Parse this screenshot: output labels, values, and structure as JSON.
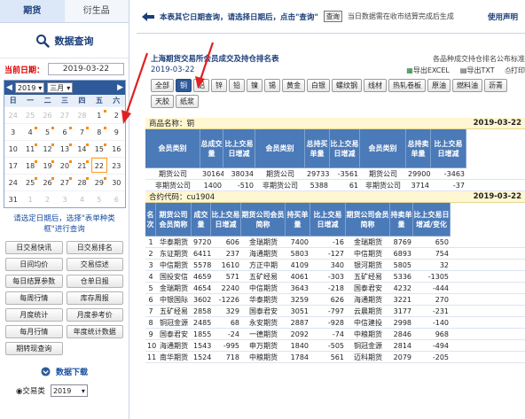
{
  "left": {
    "tabs": [
      "期货",
      "衍生品"
    ],
    "query_title": "数据查询",
    "current_date_label": "当前日期：",
    "current_date": "2019-03-22",
    "calendar": {
      "year": "2019",
      "month": "三月",
      "weekdays": [
        "日",
        "一",
        "二",
        "三",
        "四",
        "五",
        "六"
      ],
      "days": [
        {
          "d": "24",
          "dim": true
        },
        {
          "d": "25",
          "dim": true
        },
        {
          "d": "26",
          "dim": true
        },
        {
          "d": "27",
          "dim": true
        },
        {
          "d": "28",
          "dim": true
        },
        {
          "d": "1",
          "mk": true
        },
        {
          "d": "2"
        },
        {
          "d": "3"
        },
        {
          "d": "4",
          "mk": true
        },
        {
          "d": "5",
          "mk": true
        },
        {
          "d": "6",
          "mk": true
        },
        {
          "d": "7",
          "mk": true
        },
        {
          "d": "8",
          "mk": true
        },
        {
          "d": "9"
        },
        {
          "d": "10"
        },
        {
          "d": "11",
          "mk": true
        },
        {
          "d": "12",
          "mk": true
        },
        {
          "d": "13",
          "mk": true
        },
        {
          "d": "14",
          "mk": true
        },
        {
          "d": "15",
          "mk": true
        },
        {
          "d": "16"
        },
        {
          "d": "17"
        },
        {
          "d": "18",
          "mk": true
        },
        {
          "d": "19",
          "mk": true
        },
        {
          "d": "20",
          "mk": true
        },
        {
          "d": "21",
          "mk": true
        },
        {
          "d": "22",
          "today": true
        },
        {
          "d": "23"
        },
        {
          "d": "24"
        },
        {
          "d": "25",
          "mk": true
        },
        {
          "d": "26",
          "mk": true
        },
        {
          "d": "27",
          "mk": true
        },
        {
          "d": "28",
          "mk": true
        },
        {
          "d": "29",
          "mk": true
        },
        {
          "d": "30"
        },
        {
          "d": "31"
        },
        {
          "d": "1",
          "dim": true
        },
        {
          "d": "2",
          "dim": true
        },
        {
          "d": "3",
          "dim": true
        },
        {
          "d": "4",
          "dim": true
        },
        {
          "d": "5",
          "dim": true
        },
        {
          "d": "6",
          "dim": true
        }
      ]
    },
    "hint": "请选定日期后，选择\"表单种类框\"进行查询",
    "buttons": [
      "日交易快讯",
      "日交易排名",
      "日间均价",
      "交易综述",
      "每日结算参数",
      "仓单日报",
      "每周行情",
      "库存周报",
      "月度统计",
      "月度参考价",
      "每月行情",
      "年度统计数据",
      "期转现查询"
    ],
    "download_title": "数据下载",
    "download_radio": "交易类",
    "download_year": "2019"
  },
  "right": {
    "instruction": "本表其它日期查询，请选择日期后，点击\"查询\"",
    "query_btn": "查询",
    "note": "当日数据需在收市结算完成后生成",
    "declaration": "使用声明",
    "report_title": "上海期货交易所会员成交及持仓排名表",
    "report_note": "各品种成交持仓排名公布标准",
    "report_date": "2019-03-22",
    "export_excel": "导出EXCEL",
    "export_txt": "导出TXT",
    "print": "打印",
    "chips": [
      "全部",
      "铜",
      "铝",
      "锌",
      "铅",
      "镍",
      "锡",
      "黄金",
      "白银",
      "螺纹钢",
      "线材",
      "热轧卷板",
      "原油",
      "燃料油",
      "沥青",
      "天胶",
      "纸浆"
    ],
    "product_label": "商品名称：铜",
    "product_date": "2019-03-22",
    "summary_headers": [
      "会员类别",
      "总成交量",
      "比上交易日增减",
      "会员类别",
      "总持买单量",
      "比上交易日增减",
      "会员类别",
      "总持卖单量",
      "比上交易日增减"
    ],
    "summary_rows": [
      [
        "期货公司",
        "301644",
        "38034",
        "期货公司",
        "297331",
        "-3561",
        "期货公司",
        "299005",
        "-3463"
      ],
      [
        "非期货公司",
        "1400",
        "-510",
        "非期货公司",
        "5388",
        "61",
        "非期货公司",
        "3714",
        "-37"
      ]
    ],
    "contract_label": "合约代码：cu1904",
    "contract_date": "2019-03-22",
    "detail_headers": [
      "名次",
      "期货公司会员简称",
      "成交量",
      "比上交易日增减",
      "期货公司会员简称",
      "持买单量",
      "比上交易日增减",
      "期货公司会员简称",
      "持卖单量",
      "比上交易日增减/变化"
    ],
    "detail_rows": [
      [
        "1",
        "华泰期货",
        "9720",
        "606",
        "金瑞期货",
        "7400",
        "-16",
        "金瑞期货",
        "8769",
        "650"
      ],
      [
        "2",
        "东证期货",
        "6411",
        "237",
        "海通期货",
        "5803",
        "-127",
        "中信期货",
        "6893",
        "754"
      ],
      [
        "3",
        "中信期货",
        "5578",
        "1610",
        "方正中期",
        "4109",
        "340",
        "银河期货",
        "5805",
        "32"
      ],
      [
        "4",
        "国投安信",
        "4659",
        "571",
        "五矿经易",
        "4061",
        "-303",
        "五矿经易",
        "5336",
        "-1305"
      ],
      [
        "5",
        "金瑞期货",
        "4654",
        "2240",
        "中信期货",
        "3643",
        "-218",
        "国泰君安",
        "4232",
        "-444"
      ],
      [
        "6",
        "中银国际",
        "3602",
        "-1226",
        "华泰期货",
        "3259",
        "626",
        "海通期货",
        "3221",
        "270"
      ],
      [
        "7",
        "五矿经易",
        "2858",
        "329",
        "国泰君安",
        "3051",
        "-797",
        "云晨期货",
        "3177",
        "-231"
      ],
      [
        "8",
        "铜冠金源",
        "2485",
        "68",
        "永安期货",
        "2887",
        "-928",
        "中信建投",
        "2998",
        "-140"
      ],
      [
        "9",
        "国泰君安",
        "1855",
        "-24",
        "一德期货",
        "2092",
        "-74",
        "中粮期货",
        "2846",
        "968"
      ],
      [
        "10",
        "海通期货",
        "1543",
        "-995",
        "申万期货",
        "1840",
        "-505",
        "铜冠金源",
        "2814",
        "-494"
      ],
      [
        "11",
        "南华期货",
        "1524",
        "718",
        "中粮期货",
        "1784",
        "561",
        "迈科期货",
        "2079",
        "-205"
      ]
    ]
  }
}
